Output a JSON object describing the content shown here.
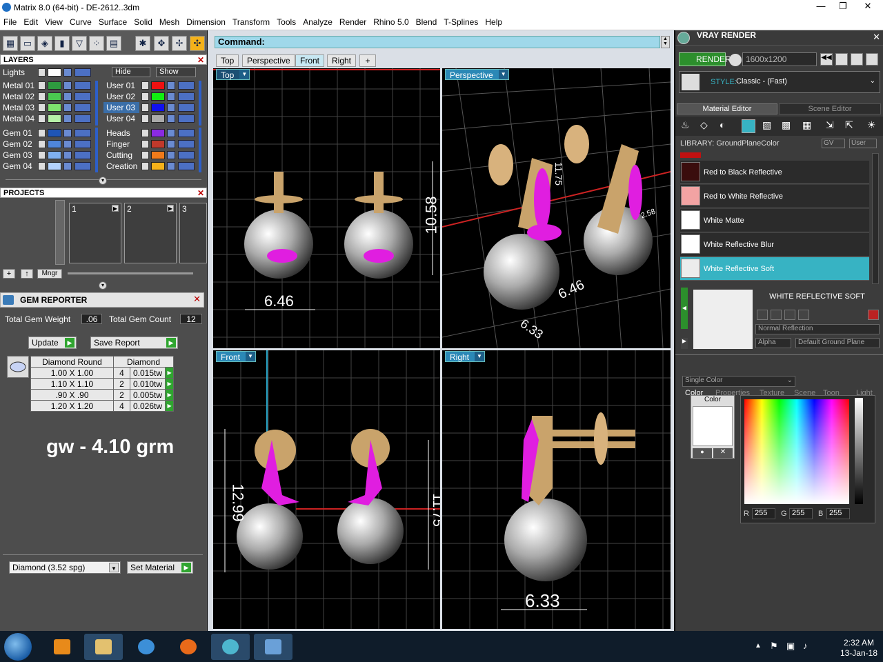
{
  "window": {
    "title": "Matrix 8.0 (64-bit) - DE-2612..3dm",
    "minimize": "—",
    "maximize": "❐",
    "close": "✕"
  },
  "menu": [
    "File",
    "Edit",
    "View",
    "Curve",
    "Surface",
    "Solid",
    "Mesh",
    "Dimension",
    "Transform",
    "Tools",
    "Analyze",
    "Render",
    "Rhino 5.0",
    "Blend",
    "T-Splines",
    "Help"
  ],
  "layers": {
    "title": "LAYERS",
    "close": "✕",
    "lights_label": "Lights",
    "hide_label": "Hide",
    "show_label": "Show",
    "left": [
      {
        "name": "Metal 01",
        "color": "#2e9b3f"
      },
      {
        "name": "Metal 02",
        "color": "#4ac850"
      },
      {
        "name": "Metal 03",
        "color": "#7ee36e"
      },
      {
        "name": "Metal 04",
        "color": "#b6f0a8"
      },
      {
        "name": "Gem 01",
        "color": "#1f55b7"
      },
      {
        "name": "Gem 02",
        "color": "#4f86db"
      },
      {
        "name": "Gem 03",
        "color": "#7fb0f0"
      },
      {
        "name": "Gem 04",
        "color": "#b3d3ff"
      }
    ],
    "right": [
      {
        "name": "User 01",
        "color": "#ee1111"
      },
      {
        "name": "User 02",
        "color": "#11ee11"
      },
      {
        "name": "User 03",
        "color": "#1111ee"
      },
      {
        "name": "User 04",
        "color": "#aaaaaa"
      },
      {
        "name": "Heads",
        "color": "#8a2be2"
      },
      {
        "name": "Finger",
        "color": "#c0392b"
      },
      {
        "name": "Cutting",
        "color": "#f07a1a"
      },
      {
        "name": "Creation",
        "color": "#f5b21a"
      }
    ],
    "selected": "User 03"
  },
  "projects": {
    "title": "PROJECTS",
    "close": "✕",
    "slots": [
      "1",
      "2",
      "3"
    ],
    "add": "+",
    "up": "↑",
    "manager": "Mngr"
  },
  "gem_reporter": {
    "title": "GEM REPORTER",
    "close": "✕",
    "total_weight_label": "Total Gem Weight",
    "total_weight": ".06",
    "total_count_label": "Total Gem Count",
    "total_count": "12",
    "update": "Update",
    "save_report": "Save Report",
    "col_shape": "Diamond Round",
    "col_type": "Diamond",
    "rows": [
      {
        "size": "1.00 X 1.00",
        "qty": "4",
        "weight": "0.015tw"
      },
      {
        "size": "1.10 X 1.10",
        "qty": "2",
        "weight": "0.010tw"
      },
      {
        "size": ".90 X .90",
        "qty": "2",
        "weight": "0.005tw"
      },
      {
        "size": "1.20 X 1.20",
        "qty": "4",
        "weight": "0.026tw"
      }
    ],
    "note": "gw - 4.10 grm",
    "material_select": "Diamond    (3.52 spg)",
    "set_material": "Set Material"
  },
  "command": {
    "label": "Command:"
  },
  "view_tabs": [
    "Top",
    "Perspective",
    "Front",
    "Right",
    "+"
  ],
  "active_view_tab": "Front",
  "viewports": {
    "top": {
      "label": "Top",
      "dim": "6.46",
      "dim_v": "10.58"
    },
    "perspective": {
      "label": "Perspective",
      "dim_a": "11.75",
      "dim_b": "6.46",
      "dim_c": "6.33",
      "dim_d": "2.58"
    },
    "front": {
      "label": "Front",
      "dim_h": "12.99",
      "dim_r": "11.75"
    },
    "right": {
      "label": "Right",
      "dim": "6.33"
    }
  },
  "vray": {
    "title": "VRAY RENDER",
    "close": "✕",
    "render": "RENDER",
    "resolution": "1600x1200",
    "style_label": "STYLE:",
    "style_value": "Classic - (Fast)",
    "tab_material": "Material Editor",
    "tab_scene": "Scene Editor",
    "library_label": "LIBRARY: GroundPlaneColor",
    "gv": "GV",
    "user": "User",
    "materials": [
      {
        "name": "Red to Black Reflective",
        "color": "#3a0d0d"
      },
      {
        "name": "Red to White Reflective",
        "color": "#f2a3a3"
      },
      {
        "name": "White Matte",
        "color": "#ffffff"
      },
      {
        "name": "White Reflective Blur",
        "color": "#ffffff"
      },
      {
        "name": "White Reflective Soft",
        "color": "#ececec"
      }
    ],
    "selected_material": "WHITE REFLECTIVE SOFT",
    "reflection": "Normal Reflection",
    "alpha": "Alpha",
    "ground": "Default Ground Plane",
    "tabs": [
      "Color",
      "Properties",
      "Texture",
      "Scene",
      "Toon",
      "Light"
    ],
    "color_mode": "Single Color",
    "color_label": "Color",
    "r_label": "R",
    "r": "255",
    "g_label": "G",
    "g": "255",
    "b_label": "B",
    "b": "255"
  },
  "taskbar": {
    "time": "2:32 AM",
    "date": "13-Jan-18"
  }
}
